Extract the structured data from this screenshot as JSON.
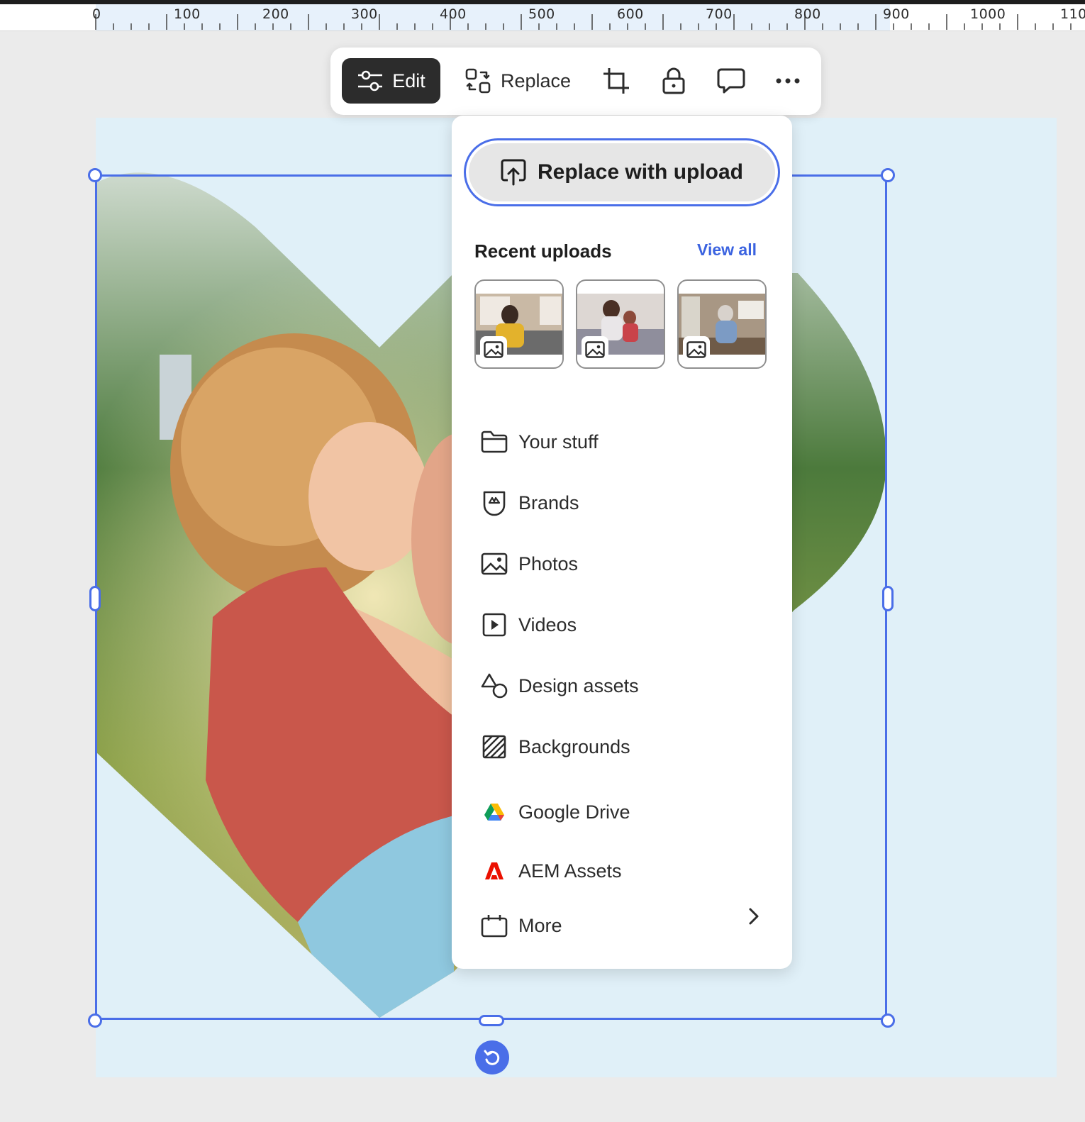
{
  "ruler": {
    "labels": [
      "0",
      "100",
      "200",
      "300",
      "400",
      "500",
      "600",
      "700",
      "800",
      "900",
      "1000",
      "1100"
    ]
  },
  "toolbar": {
    "edit_label": "Edit",
    "replace_label": "Replace",
    "icons": [
      "adjust-sliders-icon",
      "replace-swap-icon",
      "crop-icon",
      "lock-icon",
      "comment-icon",
      "more-horizontal-icon"
    ]
  },
  "replace_menu": {
    "upload_button_label": "Replace with upload",
    "recent_uploads_title": "Recent uploads",
    "view_all_label": "View all",
    "recent_thumbnails": [
      {
        "icon": "image-icon"
      },
      {
        "icon": "image-icon"
      },
      {
        "icon": "image-icon"
      }
    ],
    "items": [
      {
        "label": "Your stuff",
        "icon": "folder-icon"
      },
      {
        "label": "Brands",
        "icon": "brand-shield-icon"
      },
      {
        "label": "Photos",
        "icon": "image-icon"
      },
      {
        "label": "Videos",
        "icon": "video-play-icon"
      },
      {
        "label": "Design assets",
        "icon": "shapes-icon"
      },
      {
        "label": "Backgrounds",
        "icon": "hatched-square-icon"
      },
      {
        "label": "Google Drive",
        "icon": "google-drive-icon"
      },
      {
        "label": "AEM Assets",
        "icon": "adobe-icon"
      },
      {
        "label": "More",
        "icon": "calendar-box-icon",
        "has_submenu": true
      }
    ]
  },
  "colors": {
    "accent": "#4a6ee8",
    "link": "#3b63e0",
    "canvas_bg": "#e0f0f8",
    "toolbar_active": "#2c2c2c"
  }
}
